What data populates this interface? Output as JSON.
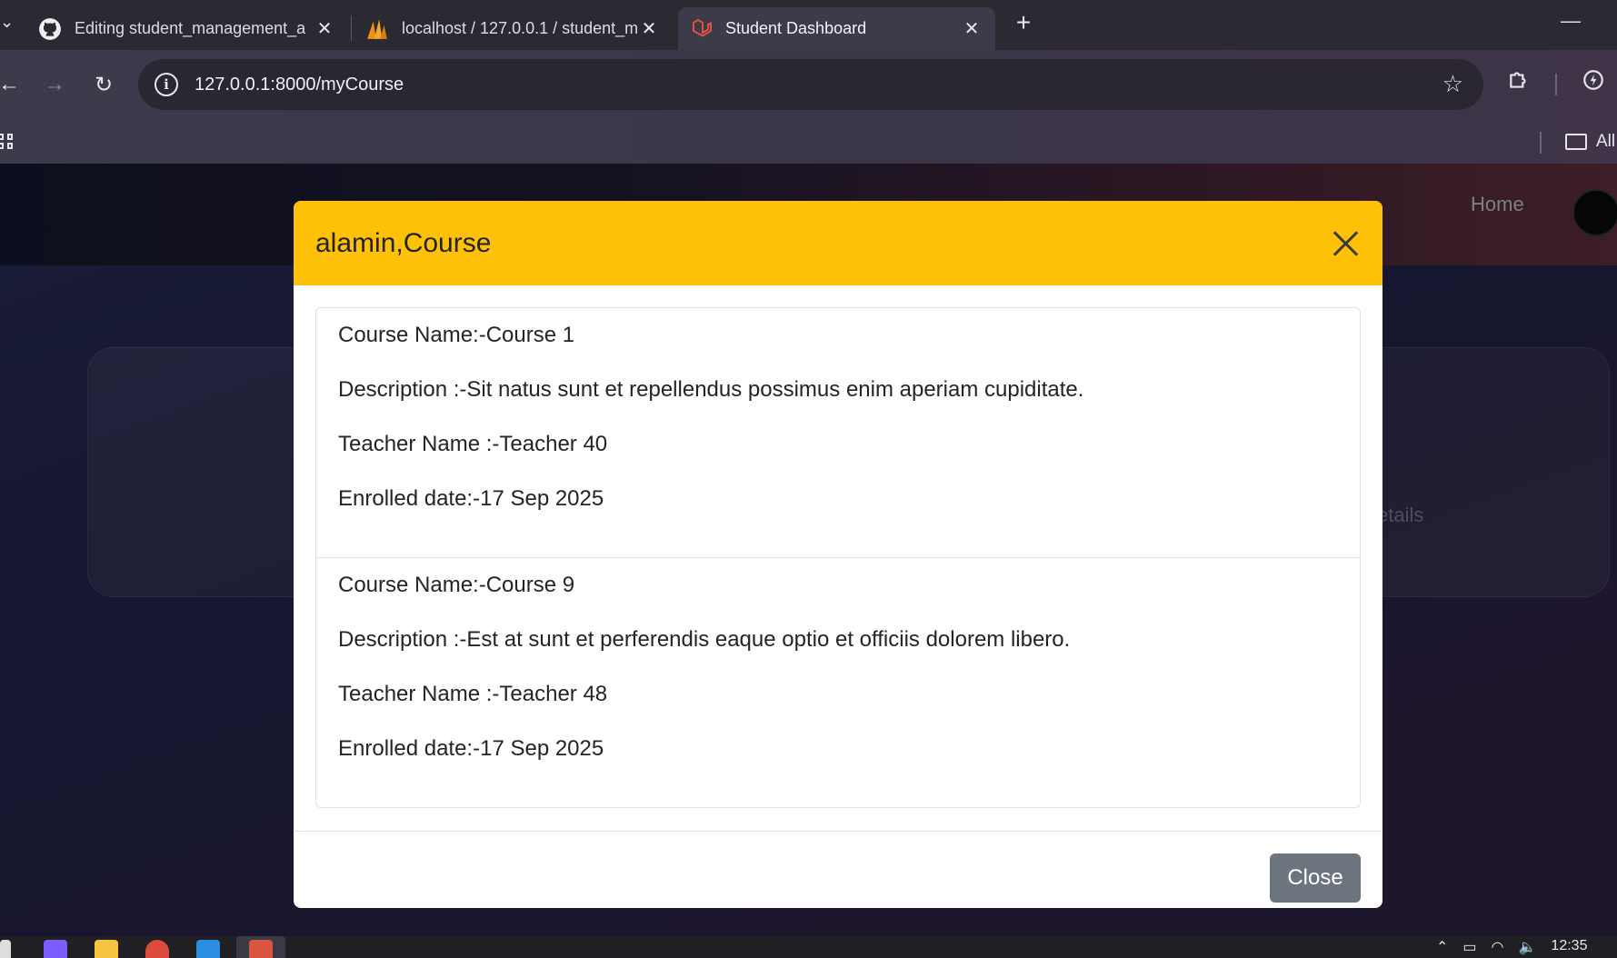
{
  "browser": {
    "tabs": [
      {
        "title": "Editing student_management_a",
        "icon": "github-icon",
        "active": false
      },
      {
        "title": "localhost / 127.0.0.1 / student_m",
        "icon": "phpmyadmin-icon",
        "active": false
      },
      {
        "title": "Student Dashboard",
        "icon": "laravel-icon",
        "active": true
      }
    ],
    "url": "127.0.0.1:8000/myCourse",
    "bookmarks_all_label": "All"
  },
  "page": {
    "nav": {
      "home_label": "Home"
    },
    "background_card_text": "etails"
  },
  "modal": {
    "title": "alamin,Course",
    "courses": [
      {
        "name": "Course Name:-Course 1",
        "description": "Description :-Sit natus sunt et repellendus possimus enim aperiam cupiditate.",
        "teacher": "Teacher Name :-Teacher 40",
        "enrolled": "Enrolled date:-17 Sep 2025"
      },
      {
        "name": "Course Name:-Course 9",
        "description": "Description :-Est at sunt et perferendis eaque optio et officiis dolorem libero.",
        "teacher": "Teacher Name :-Teacher 48",
        "enrolled": "Enrolled date:-17 Sep 2025"
      }
    ],
    "close_label": "Close"
  },
  "taskbar": {
    "clock": "12:35"
  },
  "colors": {
    "modal_header": "#ffc107",
    "close_button": "#6c757d"
  }
}
